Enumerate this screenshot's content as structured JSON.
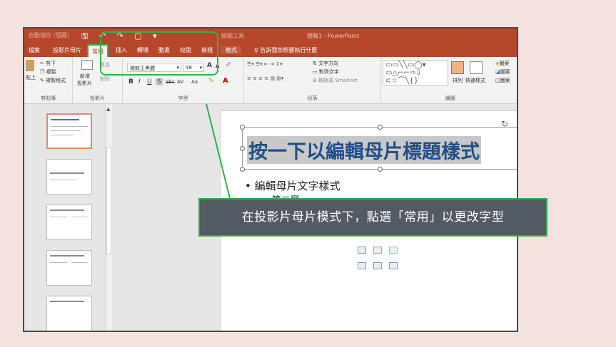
{
  "titlebar": {
    "qat_text": "自動儲存 (隱藏)",
    "quick_icons": "🖫 ↶ ↷ ▢ ▾",
    "context_tab_group": "繪圖工具",
    "window_title": "簡報1 - PowerPoint"
  },
  "tabs": [
    {
      "label": "檔案"
    },
    {
      "label": "投影片母片"
    },
    {
      "label": "常用"
    },
    {
      "label": "插入"
    },
    {
      "label": "轉場"
    },
    {
      "label": "動畫"
    },
    {
      "label": "校閱"
    },
    {
      "label": "檢視"
    },
    {
      "label": "格式"
    }
  ],
  "tell_me": "告訴我您想要執行什麼",
  "ribbon": {
    "clipboard": {
      "paste": "貼上",
      "cut": "剪下",
      "copy": "複製",
      "format_painter": "複製格式",
      "label": "剪貼簿"
    },
    "slides": {
      "new_slide": "新增",
      "new_slide2": "投影片",
      "reset": "重設",
      "delete": "刪除",
      "label": "投影片"
    },
    "font": {
      "font_name": "微軟正黑體",
      "font_size": "48",
      "grow": "A",
      "shrink": "A",
      "bold": "B",
      "italic": "I",
      "underline": "U",
      "shadow": "S",
      "strike": "abc",
      "spacing": "AV",
      "case": "Aa",
      "label": "字型"
    },
    "paragraph": {
      "text_direction": "文字方向",
      "align_text": "對齊文字",
      "smartart": "轉換成 SmartArt",
      "label": "段落"
    },
    "drawing": {
      "arrange": "排列",
      "quick_styles": "快速樣式",
      "fill": "圖案",
      "outline": "圖案",
      "effects": "圖案",
      "label": "繪圖"
    }
  },
  "slide": {
    "title": "按一下以編輯母片標題樣式",
    "bullet1": "• 編輯母片文字樣式",
    "bullet2": "• 第二層"
  },
  "thumbnails": [
    {
      "title": "按一下以編輯母片標題樣式"
    },
    {
      "title": "按一下以編輯母片標題樣式"
    },
    {
      "title": "按一下以編輯母片標題樣式"
    },
    {
      "title": "按一下以編輯母片標題樣式"
    },
    {
      "title": "按一下以編輯母片標題樣式"
    }
  ],
  "callout": "在投影片母片模式下，點選「常用」以更改字型",
  "colors": {
    "accent": "#b7472a",
    "highlight": "#2eb24b",
    "callout_bg": "#545a63",
    "title_text": "#1f4f87"
  }
}
